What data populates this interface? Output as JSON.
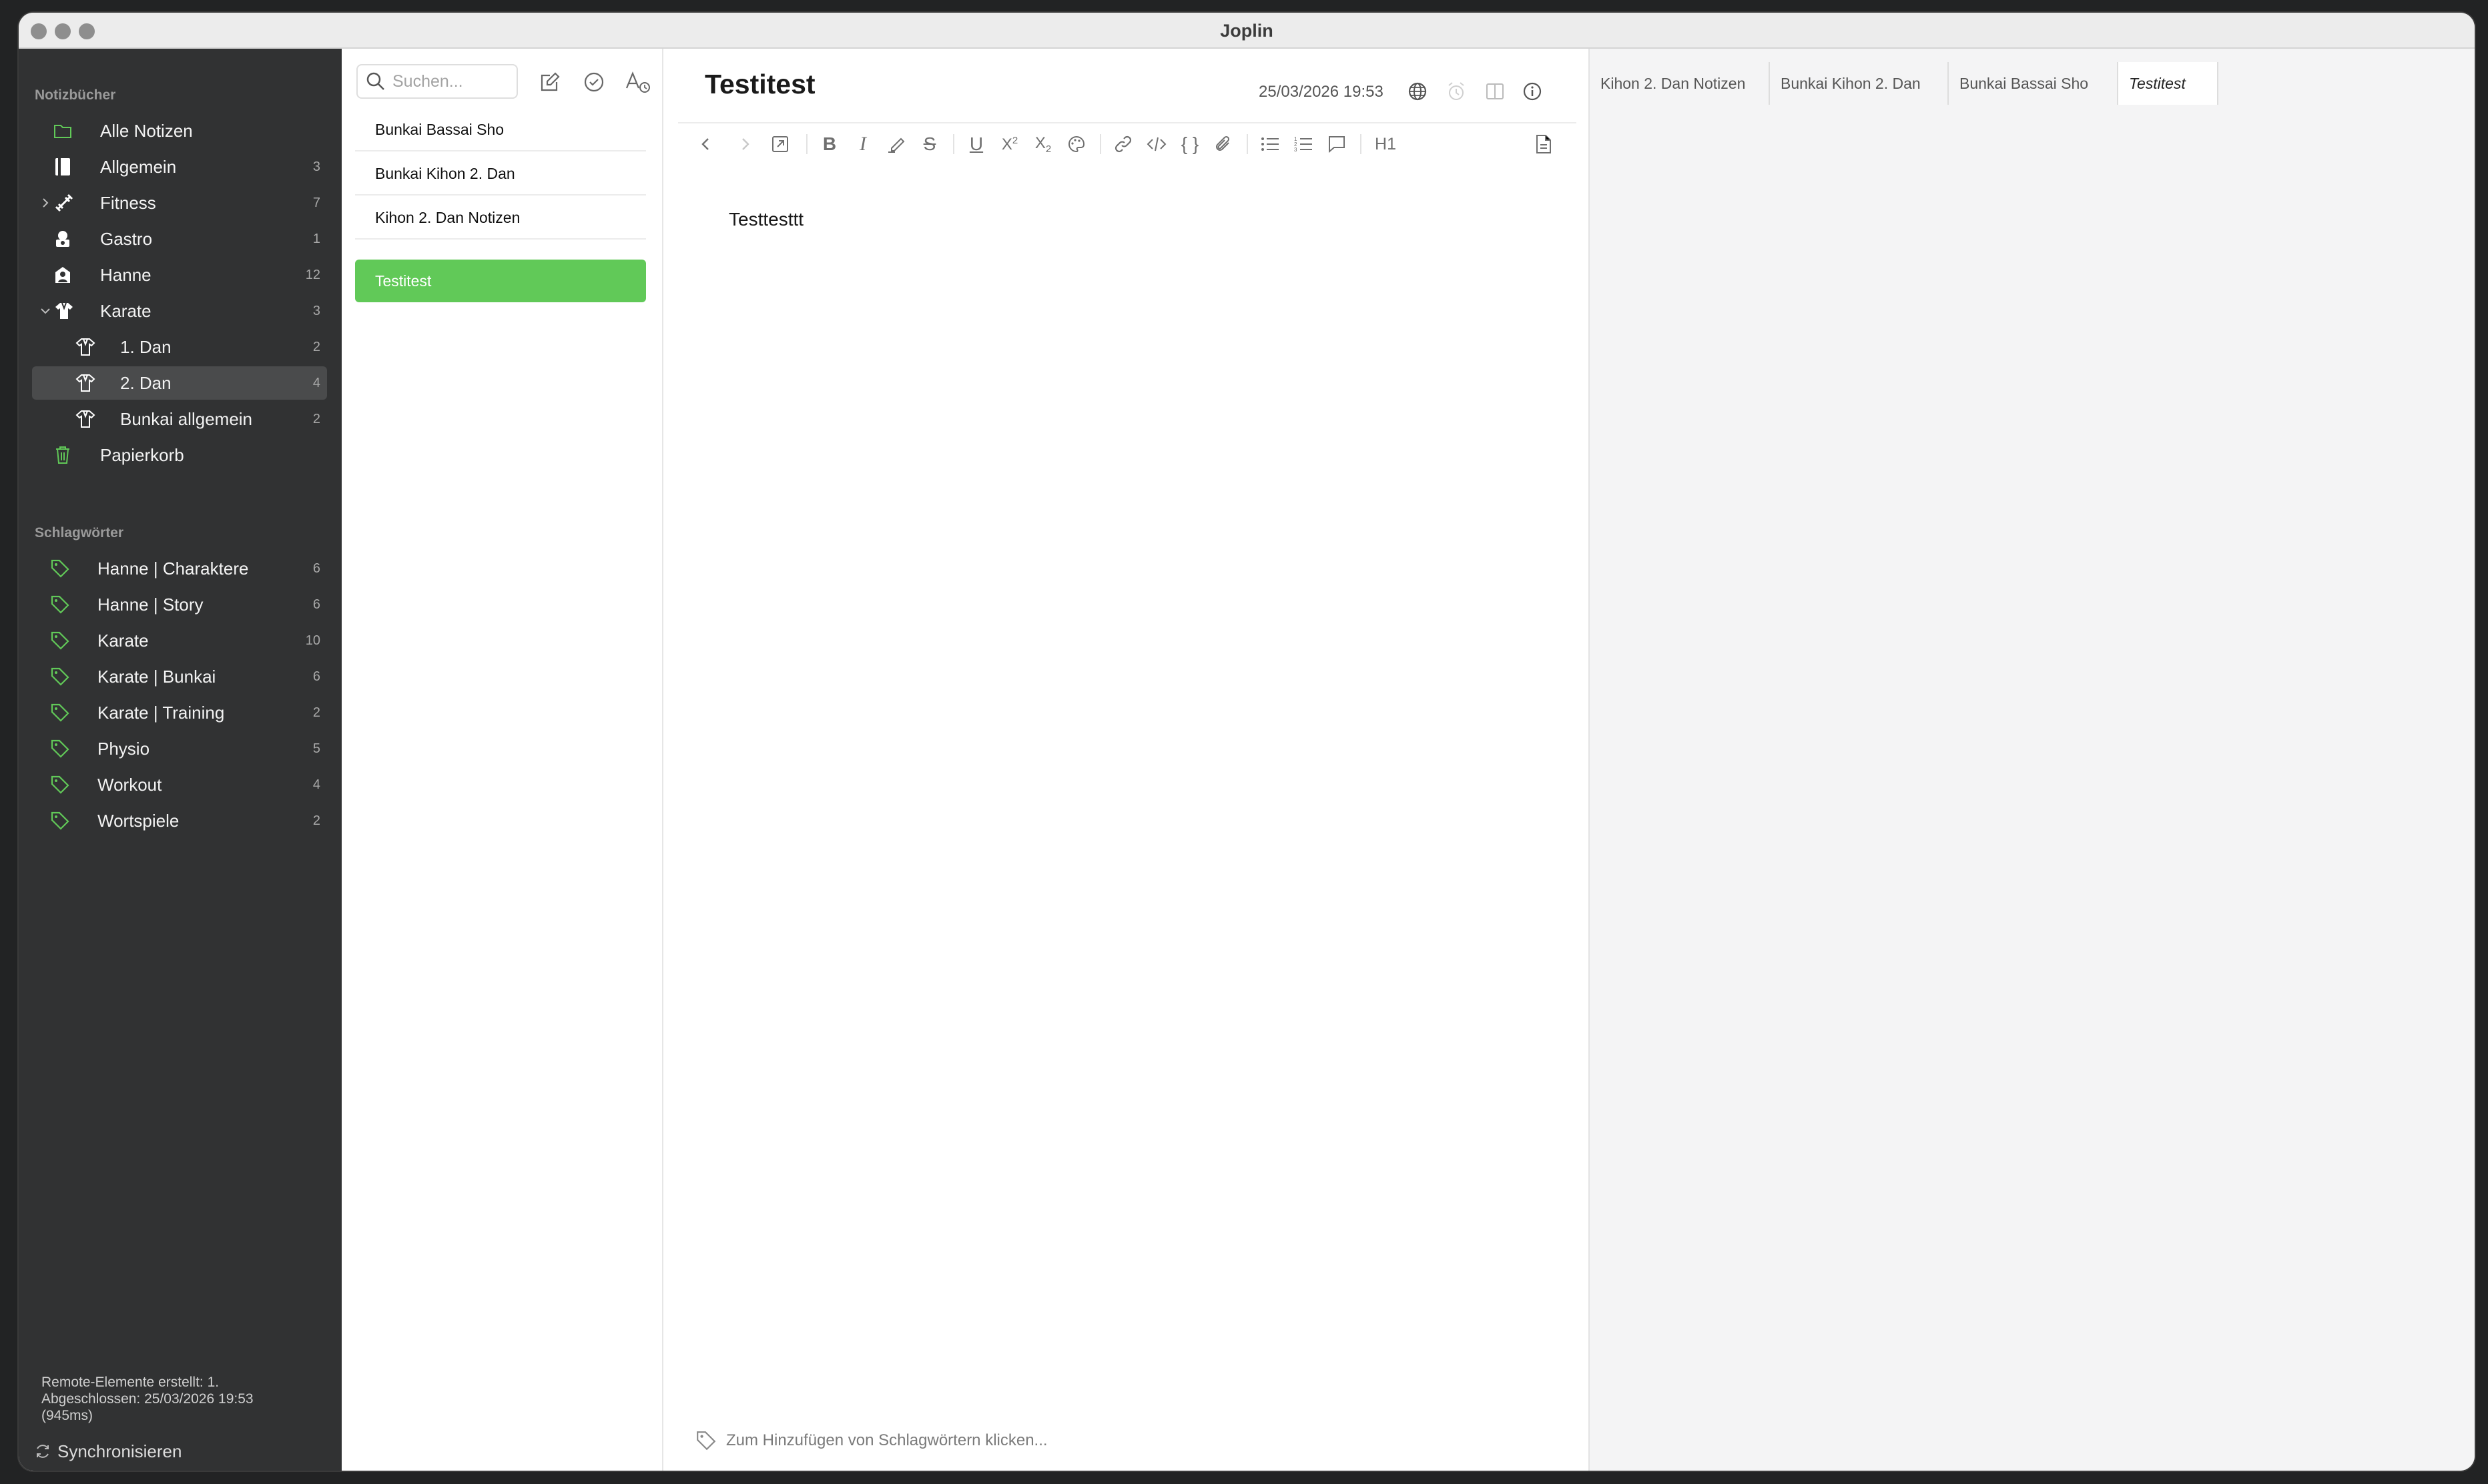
{
  "window": {
    "title": "Joplin"
  },
  "sidebar": {
    "notebooks_label": "Notizbücher",
    "notebooks": [
      {
        "label": "Alle Notizen",
        "count": "",
        "icon": "folder-icon"
      },
      {
        "label": "Allgemein",
        "count": "3",
        "icon": "notebook-icon"
      },
      {
        "label": "Fitness",
        "count": "7",
        "icon": "dumbbell-icon",
        "collapsed": true
      },
      {
        "label": "Gastro",
        "count": "1",
        "icon": "chef-icon"
      },
      {
        "label": "Hanne",
        "count": "12",
        "icon": "person-icon"
      },
      {
        "label": "Karate",
        "count": "3",
        "icon": "gi-icon",
        "expanded": true
      },
      {
        "label": "1. Dan",
        "count": "2",
        "icon": "gi-outline-icon",
        "child": true
      },
      {
        "label": "2. Dan",
        "count": "4",
        "icon": "gi-outline-icon",
        "child": true,
        "selected": true
      },
      {
        "label": "Bunkai allgemein",
        "count": "2",
        "icon": "gi-outline-icon",
        "child": true
      },
      {
        "label": "Papierkorb",
        "count": "",
        "icon": "trash-icon"
      }
    ],
    "tags_label": "Schlagwörter",
    "tags": [
      {
        "label": "Hanne | Charaktere",
        "count": "6"
      },
      {
        "label": "Hanne | Story",
        "count": "6"
      },
      {
        "label": "Karate",
        "count": "10"
      },
      {
        "label": "Karate | Bunkai",
        "count": "6"
      },
      {
        "label": "Karate | Training",
        "count": "2"
      },
      {
        "label": "Physio",
        "count": "5"
      },
      {
        "label": "Workout",
        "count": "4"
      },
      {
        "label": "Wortspiele",
        "count": "2"
      }
    ],
    "sync_status_line1": "Remote-Elemente erstellt: 1.",
    "sync_status_line2": "Abgeschlossen: 25/03/2026 19:53",
    "sync_status_line3": "(945ms)",
    "sync_button": "Synchronisieren"
  },
  "notelist": {
    "search_placeholder": "Suchen...",
    "notes": [
      {
        "title": "Bunkai Bassai Sho"
      },
      {
        "title": "Bunkai Kihon 2. Dan"
      },
      {
        "title": "Kihon 2. Dan Notizen"
      },
      {
        "title": "Testitest",
        "selected": true
      }
    ]
  },
  "editor": {
    "title": "Testitest",
    "date": "25/03/2026 19:53",
    "body": "Testtesttt",
    "heading_button": "H1",
    "tag_placeholder": "Zum Hinzufügen von Schlagwörtern klicken..."
  },
  "tabs": [
    {
      "label": "Kihon 2. Dan Notizen"
    },
    {
      "label": "Bunkai Kihon 2. Dan"
    },
    {
      "label": "Bunkai Bassai Sho"
    },
    {
      "label": "Testitest",
      "active": true
    }
  ],
  "colors": {
    "accent": "#61c958",
    "sidebar_bg": "#313233",
    "tab_panel_bg": "#f4f4f5"
  }
}
